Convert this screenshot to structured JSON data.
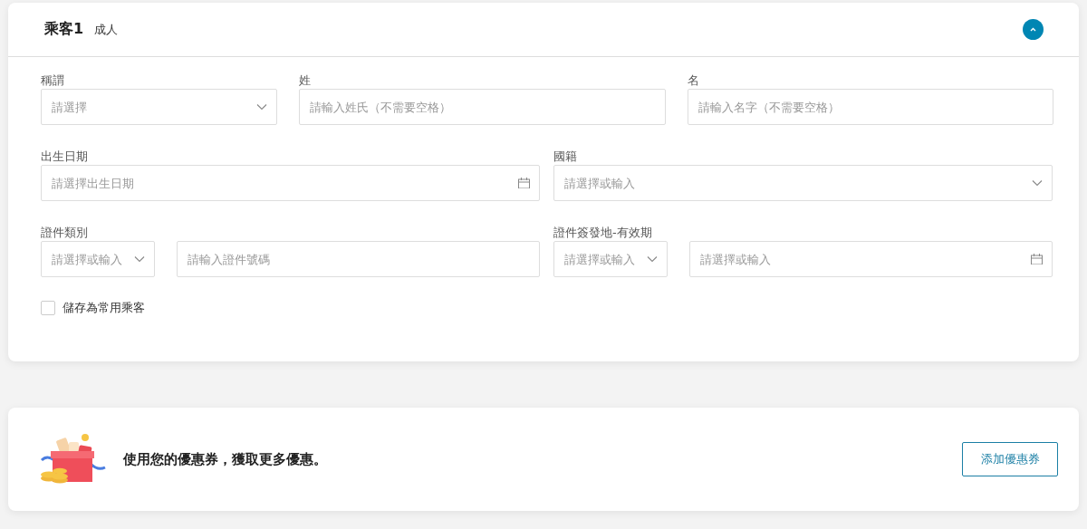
{
  "passenger": {
    "title": "乘客1",
    "type": "成人",
    "expanded": true
  },
  "form_rows": [
    {
      "groups": [
        {
          "label": "稱謂",
          "inputs": [
            {
              "kind": "select",
              "placeholder": "請選擇"
            }
          ]
        },
        {
          "label": "姓",
          "inputs": [
            {
              "kind": "text",
              "placeholder": "請輸入姓氏（不需要空格）"
            }
          ]
        },
        {
          "label": "名",
          "inputs": [
            {
              "kind": "text",
              "placeholder": "請輸入名字（不需要空格）"
            }
          ]
        }
      ]
    },
    {
      "groups": [
        {
          "label": "出生日期",
          "inputs": [
            {
              "kind": "date",
              "placeholder": "請選擇出生日期"
            }
          ]
        },
        {
          "label": "國籍",
          "inputs": [
            {
              "kind": "select",
              "placeholder": "請選擇或輸入"
            }
          ]
        }
      ]
    },
    {
      "groups": [
        {
          "label": "證件類別",
          "inputs": [
            {
              "kind": "select",
              "placeholder": "請選擇或輸入"
            },
            {
              "kind": "text",
              "placeholder": "請輸入證件號碼"
            }
          ]
        },
        {
          "label": "證件簽發地-有效期",
          "inputs": [
            {
              "kind": "select",
              "placeholder": "請選擇或輸入"
            },
            {
              "kind": "date",
              "placeholder": "請選擇或輸入"
            }
          ]
        }
      ]
    }
  ],
  "save_passenger": {
    "label": "儲存為常用乘客",
    "checked": false
  },
  "coupon": {
    "message": "使用您的優惠券，獲取更多優惠。",
    "button": "添加優惠券"
  }
}
